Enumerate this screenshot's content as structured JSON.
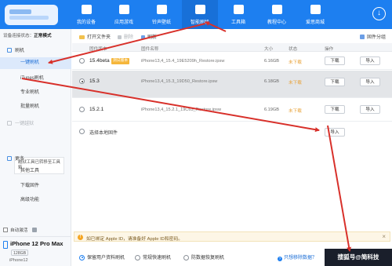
{
  "nav": {
    "items": [
      {
        "label": "我的设备",
        "icon": "device-icon"
      },
      {
        "label": "应用游戏",
        "icon": "apps-icon"
      },
      {
        "label": "铃声壁纸",
        "icon": "ringtone-icon"
      },
      {
        "label": "智能刷机",
        "icon": "flash-icon"
      },
      {
        "label": "工具箱",
        "icon": "toolbox-icon"
      },
      {
        "label": "教程中心",
        "icon": "tutorial-icon"
      },
      {
        "label": "爱思商城",
        "icon": "store-icon"
      }
    ],
    "active_index": 3,
    "download_icon": "download-icon",
    "accent": "#1d7ff0"
  },
  "sidebar": {
    "connection_label": "设备连接状态：",
    "connection_value": "正常模式",
    "flash_group": "刷机",
    "items": [
      {
        "label": "一键刷机"
      },
      {
        "label": "iTunes刷机"
      },
      {
        "label": "专业刷机"
      },
      {
        "label": "批量刷机"
      }
    ],
    "jailbreak_label": "一键越狱",
    "jailbreak_note": "越狱工具已转移至工具箱",
    "more_group": "更多",
    "more_items": [
      {
        "label": "其他工具"
      },
      {
        "label": "下载固件"
      },
      {
        "label": "高级功能"
      }
    ],
    "auto_activate": "自动激活"
  },
  "device": {
    "name": "iPhone 12 Pro Max",
    "capacity": "128GB",
    "model": "iPhone12"
  },
  "toolbar": {
    "open_folder": "打开文件夹",
    "delete": "删除",
    "refresh": "刷新",
    "firmware_group": "固件分组"
  },
  "table": {
    "headers": {
      "version": "固件版本",
      "name": "固件名称",
      "size": "大小",
      "status": "状态",
      "action": "操作"
    },
    "rows": [
      {
        "version": "15.4beta",
        "tag": "测试版本",
        "file": "iPhone13,4_15.4_19E5209h_Restore.ipsw",
        "size": "6.16GB",
        "status": "未下载",
        "download": "下载",
        "import": "导入",
        "selected": false
      },
      {
        "version": "15.3",
        "tag": "",
        "file": "iPhone13,4_15.3_19D50_Restore.ipsw",
        "size": "6.18GB",
        "status": "未下载",
        "download": "下载",
        "import": "导入",
        "selected": true
      },
      {
        "version": "15.2.1",
        "tag": "",
        "file": "iPhone13,4_15.2.1_19C63_Restore.ipsw",
        "size": "6.19GB",
        "status": "未下载",
        "download": "下载",
        "import": "导入",
        "selected": false
      }
    ],
    "local_label": "选择本地固件",
    "local_import": "导入"
  },
  "notice": {
    "text": "如已绑定 Apple ID，请准备好 Apple ID和密码。"
  },
  "modes": {
    "options": [
      {
        "label": "保留用户资料刷机",
        "checked": true
      },
      {
        "label": "常规快速刷机",
        "checked": false
      },
      {
        "label": "防数据恢复刷机",
        "checked": false
      }
    ],
    "link": "只想移除数据？",
    "watermark": "搜狐号@简科技"
  },
  "annotation_color": "#d8302a"
}
